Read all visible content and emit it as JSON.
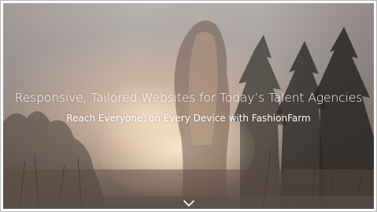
{
  "hero": {
    "headline": "Responsive, Tailored Websites for Today’s Talent Agencies",
    "subline": "Reach Everyone, on Every Device with FashionFarm"
  },
  "icons": {
    "scroll_down": "chevron-down-icon"
  },
  "colors": {
    "text": "#ffffff",
    "bottom_bar": "#5a5050"
  }
}
